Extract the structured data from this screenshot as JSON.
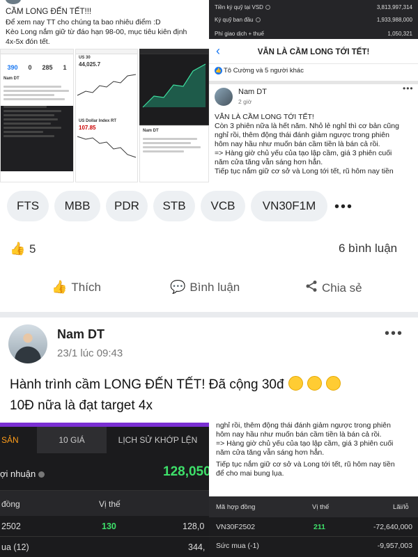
{
  "top_left": {
    "lines": [
      "CẦM LONG ĐẾN TẾT!!!",
      "Để xem nay TT cho chúng ta bao nhiêu điểm :D",
      "Kèo Long nắm giữ từ đáo hạn 98-00, mục tiêu kiên định",
      "4x-5x đón tết."
    ],
    "mini_numbers": [
      "390",
      "0",
      "285",
      "1"
    ],
    "mini_labels": [
      "Nam DT",
      "US 30",
      "44,025.7",
      "US Dollar Index RT",
      "107.85",
      "Nam DT"
    ]
  },
  "top_right": {
    "rows": [
      {
        "label": "Tiền ký quỹ tại VSD",
        "value": "3,813,997,314"
      },
      {
        "label": "Ký quỹ ban đầu",
        "value": "1,933,988,000"
      },
      {
        "label": "Phí giao dịch + thuế",
        "value": "1,050,321"
      }
    ],
    "header_title": "VẪN LÀ CẦM LONG TỚI TẾT!",
    "likes_text": "Tô Cường và 5 người khác",
    "author": "Nam DT",
    "time": "2 giờ",
    "body": [
      "VẪN LÀ CẦM LONG TỚI TẾT!",
      "Còn 3 phiên nữa là hết năm. Nhỏ lẻ nghỉ thì cơ bản cũng",
      "nghỉ rồi, thêm động thái đánh giảm ngược trong phiên",
      "hôm nay hầu như muốn bán cầm tiền là bán cả rồi.",
      "=> Hàng giờ chủ yếu của tạo lập cầm, giá 3 phiên cuối",
      "năm cửa tăng vẫn sáng hơn hẳn.",
      "Tiếp tục nắm giữ cơ sở và Long tới tết, rũ hôm nay tiền"
    ]
  },
  "tags": [
    "FTS",
    "MBB",
    "PDR",
    "STB",
    "VCB",
    "VN30F1M"
  ],
  "more_tags": "•••",
  "reactions": {
    "likes": "5",
    "comments": "6 bình luận"
  },
  "actions": {
    "like": "Thích",
    "comment": "Bình luận",
    "share": "Chia sẻ"
  },
  "post2": {
    "author": "Nam DT",
    "time": "23/1 lúc 09:43",
    "more": "•••",
    "line1": "Hành trình cầm LONG ĐẾN TẾT! Đã cộng 30đ",
    "line2": "10Đ nữa là đạt target 4x"
  },
  "bottom_left": {
    "tabs": [
      "SẢN",
      "10 GIÁ",
      "LỊCH SỬ KHỚP LỆN"
    ],
    "pnl_label": "ợi nhuận",
    "pnl_value": "128,050",
    "headers": [
      "đồng",
      "Vị thế"
    ],
    "rows": [
      {
        "code": "2502",
        "pos": "130",
        "val": "128,0"
      },
      {
        "code": "ua (12)",
        "pos": "",
        "val": "344,"
      }
    ],
    "colors": {
      "accent": "#3ee06a",
      "tab": "#ff9d1a",
      "bar": "#7a2fd2"
    }
  },
  "bottom_right": {
    "lines": [
      "nghỉ rồi, thêm động thái đánh giảm ngược trong phiên",
      "hôm nay hầu như muốn bán cầm tiền là bán cả rồi.",
      "=> Hàng giờ chủ yếu của tạo lập cầm, giá 3 phiên cuối",
      "năm cửa tăng vẫn sáng hơn hẳn.",
      "Tiếp tục nắm giữ cơ sở và Long tới tết, rũ hôm nay tiền",
      "để cho mai bung lụa."
    ],
    "headers": [
      "Mã hợp đồng",
      "Vị thế",
      "Lãi/lỗ"
    ],
    "rows": [
      {
        "code": "VN30F2502",
        "pos": "211",
        "pnl": "-72,640,000"
      },
      {
        "code": "Sức mua (-1)",
        "pos": "",
        "pnl": "-9,957,003"
      }
    ]
  }
}
